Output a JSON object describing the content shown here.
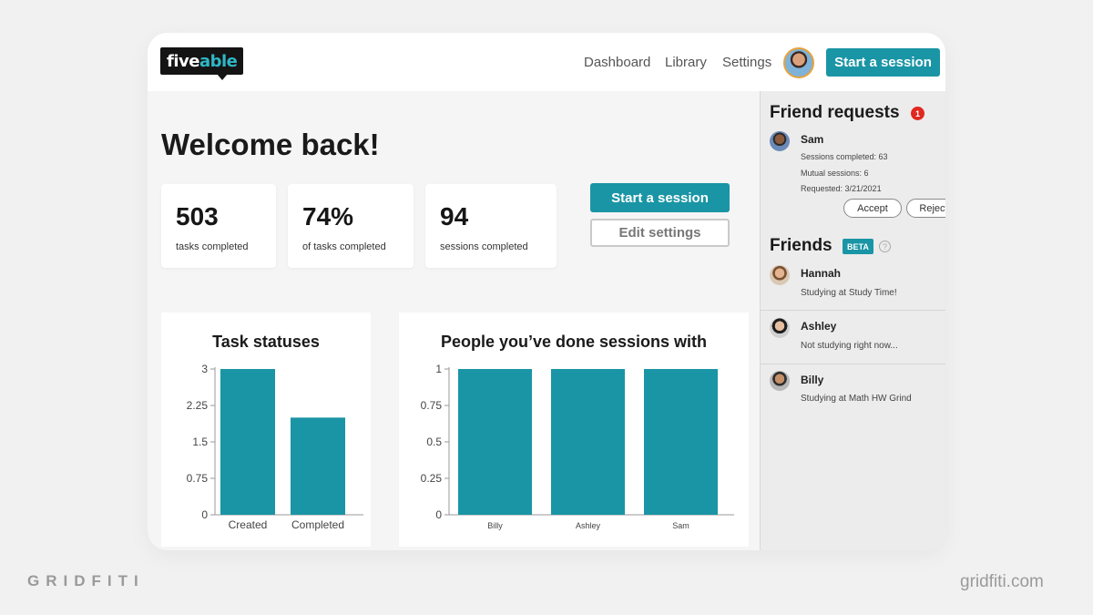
{
  "header": {
    "logo_part1": "five",
    "logo_part2": "able",
    "nav": [
      "Dashboard",
      "Library",
      "Settings"
    ],
    "cta": "Start a session"
  },
  "main": {
    "welcome": "Welcome back!",
    "stats": [
      {
        "value": "503",
        "label": "tasks completed"
      },
      {
        "value": "74%",
        "label": "of tasks completed"
      },
      {
        "value": "94",
        "label": "sessions completed"
      }
    ],
    "start_button": "Start a session",
    "edit_button": "Edit settings"
  },
  "chart_data": [
    {
      "type": "bar",
      "title": "Task statuses",
      "categories": [
        "Created",
        "Completed"
      ],
      "values": [
        3,
        2
      ],
      "ylim": [
        0,
        3
      ],
      "yticks": [
        "0",
        "0.75",
        "1.5",
        "2.25",
        "3"
      ],
      "color": "#1a95a5"
    },
    {
      "type": "bar",
      "title": "People you’ve done sessions with",
      "categories": [
        "Billy",
        "Ashley",
        "Sam"
      ],
      "values": [
        1,
        1,
        1
      ],
      "ylim": [
        0,
        1
      ],
      "yticks": [
        "0",
        "0.25",
        "0.5",
        "0.75",
        "1"
      ],
      "color": "#1a95a5"
    }
  ],
  "sidebar": {
    "requests_title": "Friend requests",
    "requests_count": "1",
    "request": {
      "name": "Sam",
      "sessions_completed": "Sessions completed: 63",
      "mutual_sessions": "Mutual sessions: 6",
      "requested": "Requested: 3/21/2021",
      "accept": "Accept",
      "reject": "Reject"
    },
    "friends_title": "Friends",
    "beta": "BETA",
    "help": "?",
    "friends": [
      {
        "name": "Hannah",
        "status": "Studying at Study Time!"
      },
      {
        "name": "Ashley",
        "status": "Not studying right now..."
      },
      {
        "name": "Billy",
        "status": "Studying at Math HW Grind"
      }
    ]
  },
  "watermark": {
    "left": "GRIDFITI",
    "right": "gridfiti.com"
  }
}
